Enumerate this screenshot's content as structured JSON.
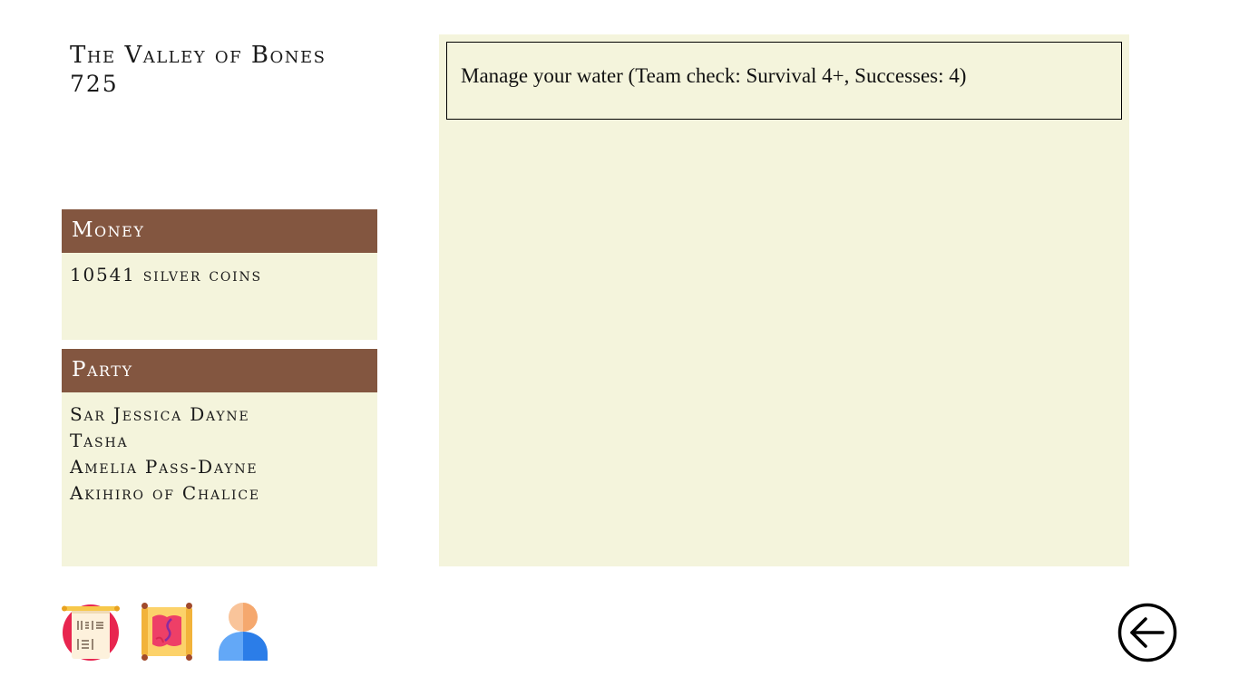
{
  "header": {
    "title": "The Valley of Bones",
    "day": "725"
  },
  "money": {
    "heading": "Money",
    "amount": "10541 silver coins"
  },
  "party": {
    "heading": "Party",
    "members": [
      "Sar Jessica Dayne",
      "Tasha",
      "Amelia Pass-Dayne",
      "Akihiro of Chalice"
    ]
  },
  "event": {
    "text": "Manage your water (Team check: Survival 4+, Successes: 4)"
  },
  "toolbar": {
    "icons": [
      "journal-scroll-icon",
      "map-scroll-icon",
      "character-icon"
    ]
  },
  "navigation": {
    "back_icon": "back-arrow-icon"
  },
  "colors": {
    "panel_header": "#835640",
    "panel_bg": "#f4f4dc",
    "page_bg": "#ffffff"
  }
}
